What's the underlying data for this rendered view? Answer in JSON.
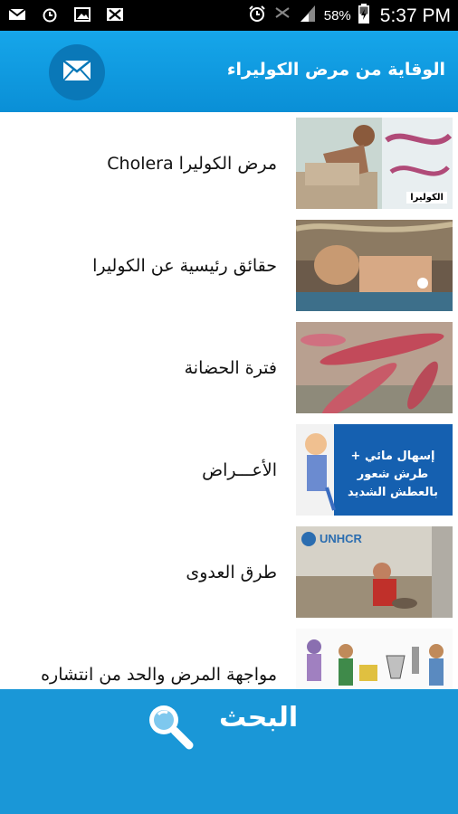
{
  "status_bar": {
    "battery_percent": "58%",
    "time": "5:37 PM",
    "icons": [
      "envelope-icon",
      "alarm-icon",
      "image-icon",
      "no-image-icon",
      "alarm-clock-icon",
      "signal-mute-icon",
      "signal-icon",
      "battery-charging-icon"
    ]
  },
  "appbar": {
    "title": "الوقاية من مرض الكوليراء",
    "mail_icon": "envelope-icon"
  },
  "list": {
    "items": [
      {
        "label": "مرض الكوليرا Cholera",
        "thumb_caption": "الكوليرا"
      },
      {
        "label": "حقائق رئيسية عن الكوليرا"
      },
      {
        "label": "فترة الحضانة"
      },
      {
        "label": "الأعـــراض",
        "thumb_text": "إسهال مائي + طرش شعور بالعطش الشديد"
      },
      {
        "label": "طرق العدوى",
        "thumb_text": "UNHCR"
      },
      {
        "label": "مواجهة المرض والحد من انتشاره"
      }
    ]
  },
  "bottom": {
    "search_label": "البحث",
    "search_icon": "magnifier-icon"
  },
  "colors": {
    "accent": "#16a6ea",
    "bottom_bar": "#1a97d7",
    "mail_button": "#0a78b8"
  }
}
